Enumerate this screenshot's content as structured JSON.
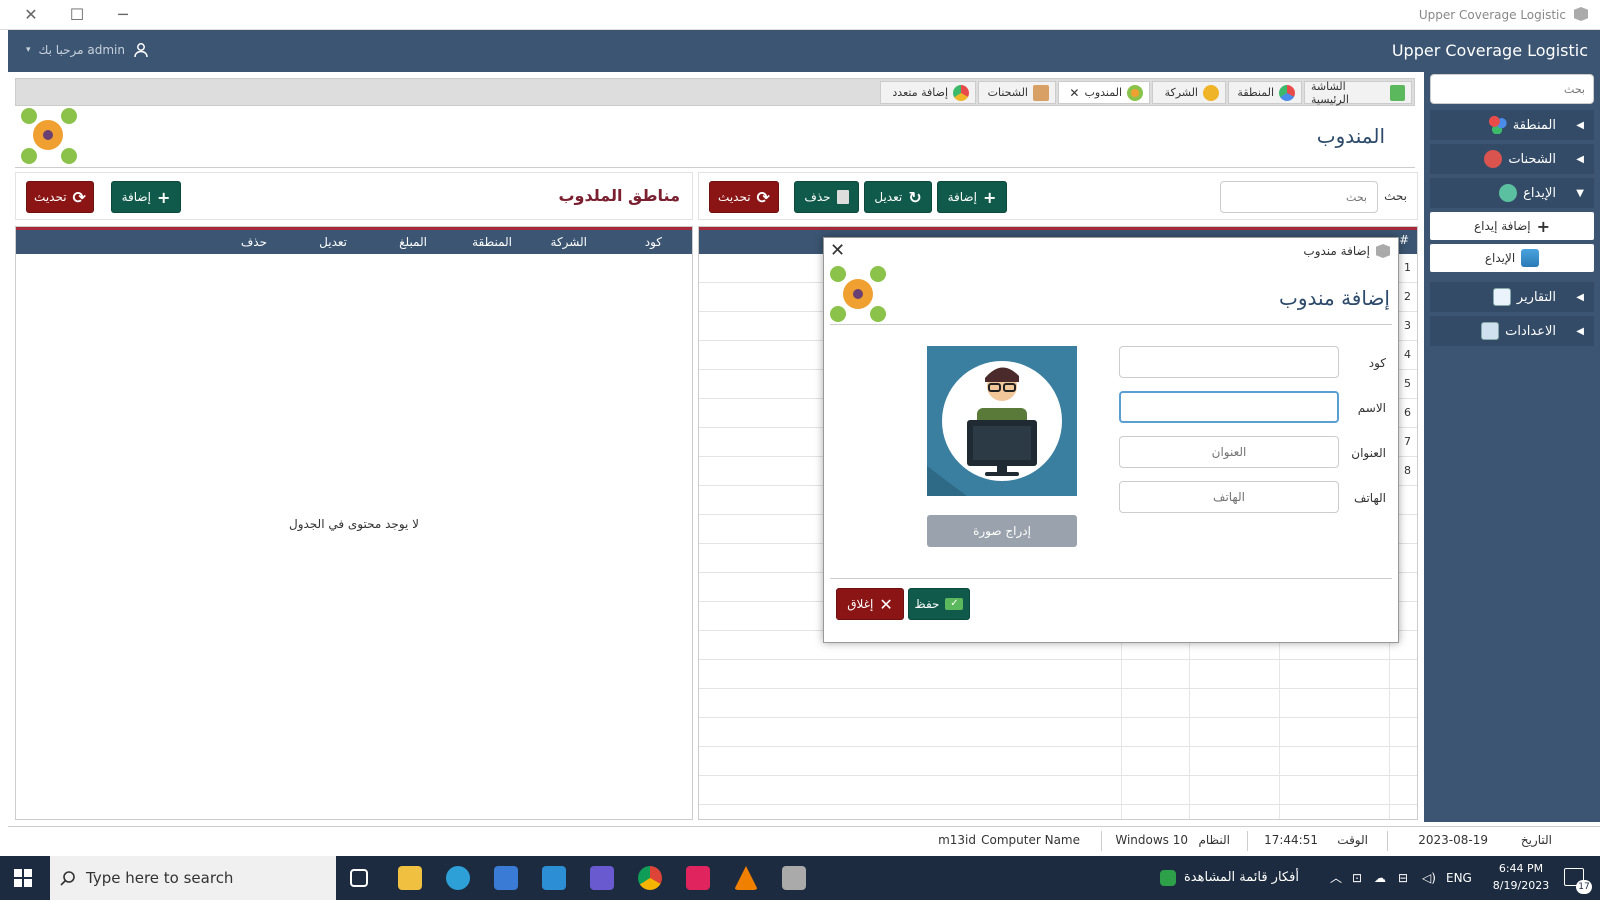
{
  "window": {
    "title": "Upper Coverage Logistic"
  },
  "header": {
    "brand": "Upper Coverage Logistic",
    "user_greeting": "مرحبا بك admin"
  },
  "sidebar": {
    "search_placeholder": "بحث",
    "items": [
      {
        "label": "المنطقة",
        "icon": "region-icon"
      },
      {
        "label": "الشحنات",
        "icon": "shipments-icon"
      },
      {
        "label": "الإيداع",
        "icon": "deposit-icon",
        "expanded": true
      },
      {
        "label": "التقارير",
        "icon": "reports-icon"
      },
      {
        "label": "الاعدادات",
        "icon": "settings-icon"
      }
    ],
    "subitems": [
      {
        "label": "إضافة إيداع",
        "icon": "plus-icon"
      },
      {
        "label": "الإيداع",
        "icon": "deposit-icon"
      }
    ]
  },
  "tabs": [
    {
      "label": "الشاشة الرئيسية"
    },
    {
      "label": "المنطقة"
    },
    {
      "label": "الشركة"
    },
    {
      "label": "المندوب",
      "active": true
    },
    {
      "label": "الشحنات"
    },
    {
      "label": "إضافة متعدد"
    }
  ],
  "page": {
    "title": "المندوب"
  },
  "right_toolbar": {
    "search_label": "بحث",
    "search_placeholder": "بحث",
    "add": "إضافة",
    "edit": "تعديل",
    "delete": "حذف",
    "refresh": "تحديث"
  },
  "left_toolbar": {
    "title": "مناطق الملدوب",
    "add": "إضافة",
    "refresh": "تحديث"
  },
  "left_table": {
    "columns": [
      "كود",
      "الشركة",
      "المنطقة",
      "المبلغ",
      "تعديل",
      "حذف"
    ],
    "empty_message": "لا يوجد محتوى في الجدول"
  },
  "right_table": {
    "header_hash": "#",
    "row_numbers": [
      "1",
      "2",
      "3",
      "4",
      "5",
      "6",
      "7",
      "8"
    ]
  },
  "modal": {
    "title": "إضافة مندوب",
    "heading": "إضافة مندوب",
    "fields": [
      {
        "label": "كود",
        "value": "",
        "placeholder": ""
      },
      {
        "label": "الاسم",
        "value": "",
        "placeholder": "",
        "focused": true
      },
      {
        "label": "العنوان",
        "value": "",
        "placeholder": "العنوان"
      },
      {
        "label": "الهاتف",
        "value": "",
        "placeholder": "الهاتف"
      }
    ],
    "insert_image": "إدراج صورة",
    "save": "حفظ",
    "close": "إغلاق"
  },
  "statusbar": {
    "date_label": "التاريخ",
    "date": "2023-08-19",
    "time_label": "الوقت",
    "time": "17:44:51",
    "os_label": "النظام",
    "os": "Windows 10",
    "computer_label": "Computer Name",
    "computer": "m13id"
  },
  "taskbar": {
    "search_placeholder": "Type here to search",
    "news": "أفكار قائمة المشاهدة",
    "lang": "ENG",
    "clock_time": "6:44 PM",
    "clock_date": "8/19/2023",
    "notifications": "17"
  },
  "colors": {
    "header": "#3b5572",
    "green": "#0f5a4a",
    "red": "#8b1515",
    "accent_border": "#a62a3a"
  }
}
